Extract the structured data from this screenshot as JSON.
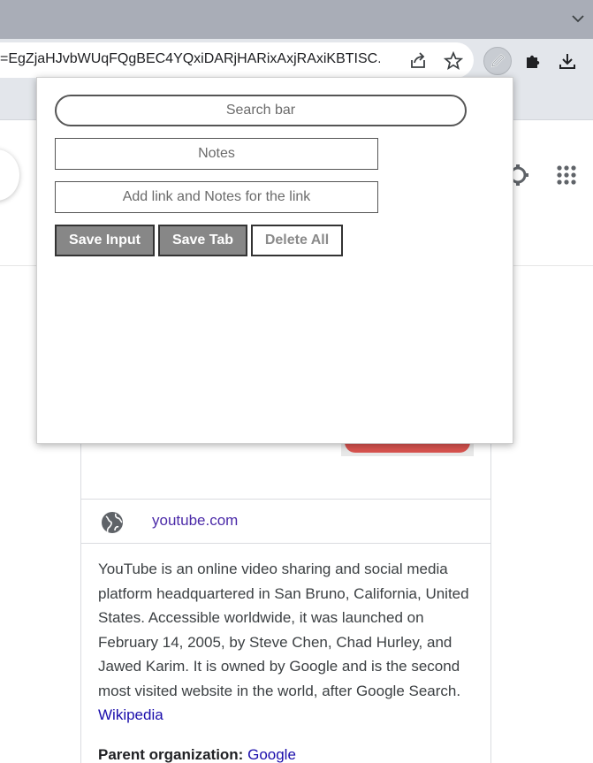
{
  "browser": {
    "url": "=EgZjaHJvbWUqFQgBEC4YQxiDARjHARixAxjRAxiKBTISC...",
    "icons": [
      "share-icon",
      "star-icon",
      "pencil-icon",
      "puzzle-icon",
      "download-icon",
      "chevron-down-icon"
    ]
  },
  "popup": {
    "search_placeholder": "Search bar",
    "notes_placeholder": "Notes",
    "link_placeholder": "Add link and Notes for the link",
    "buttons": {
      "save_input": "Save Input",
      "save_tab": "Save Tab",
      "delete_all": "Delete All"
    }
  },
  "knowledge_panel": {
    "site": "youtube.com",
    "description": "YouTube is an online video sharing and social media platform headquartered in San Bruno, California, United States. Accessible worldwide, it was launched on February 14, 2005, by Steve Chen, Chad Hurley, and Jawed Karim. It is owned by Google and is the second most visited website in the world, after Google Search.",
    "source_link": "Wikipedia",
    "parent_label": "Parent organization:",
    "parent_value": "Google"
  },
  "colors": {
    "accent_button": "#878787",
    "link": "#1a0dab",
    "visited_link": "#4b2aa8"
  }
}
